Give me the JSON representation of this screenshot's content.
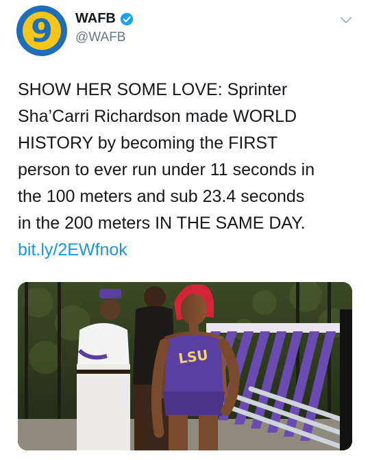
{
  "account": {
    "avatar_number": "9",
    "display_name": "WAFB",
    "handle": "@WAFB"
  },
  "tweet": {
    "lines": [
      "SHOW HER SOME LOVE: Sprinter",
      "Sha’Carri Richardson made WORLD",
      "HISTORY by becoming the FIRST",
      "person to ever run under 11 seconds in",
      "the 100 meters and sub 23.4 seconds",
      "in the 200 meters IN THE SAME DAY."
    ],
    "link": "bit.ly/2EWfnok"
  },
  "media": {
    "jersey_text": "LSU"
  },
  "colors": {
    "link": "#1b95e0",
    "handle": "#657786",
    "verified": "#1da1f2",
    "brand_blue": "#1f6fb8",
    "brand_yellow": "#f5c518",
    "lsu_purple": "#5b3fa0"
  },
  "icons": [
    "verified-badge-icon",
    "chevron-down-icon"
  ]
}
